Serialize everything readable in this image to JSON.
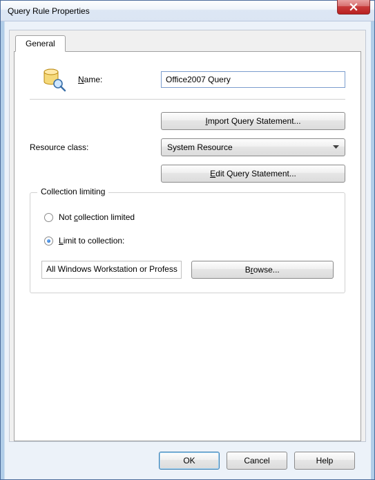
{
  "window": {
    "title": "Query Rule Properties"
  },
  "tab": {
    "label": "General"
  },
  "form": {
    "name_label_pre": "",
    "name_label_u": "N",
    "name_label_post": "ame:",
    "name_value": "Office2007 Query",
    "import_pre": "",
    "import_u": "I",
    "import_post": "mport Query Statement...",
    "resource_label": "Resource class:",
    "resource_value": "System Resource",
    "edit_pre": "",
    "edit_u": "E",
    "edit_post": "dit Query Statement..."
  },
  "group": {
    "legend": "Collection limiting",
    "opt1_pre": "Not ",
    "opt1_u": "c",
    "opt1_post": "ollection limited",
    "opt2_pre": "",
    "opt2_u": "L",
    "opt2_post": "imit to collection:",
    "collection_value": "All Windows Workstation or Profess",
    "browse_pre": "B",
    "browse_u": "r",
    "browse_post": "owse..."
  },
  "buttons": {
    "ok": "OK",
    "cancel": "Cancel",
    "help": "Help"
  }
}
